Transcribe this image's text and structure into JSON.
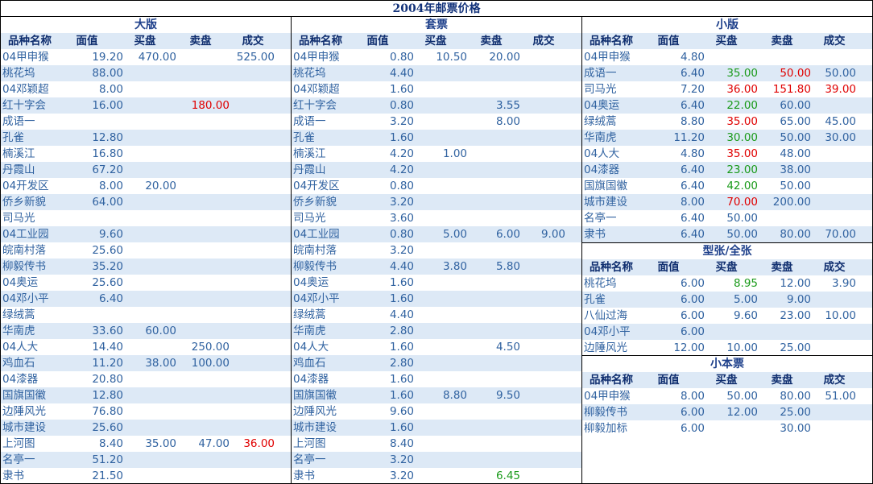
{
  "title": "2004年邮票价格",
  "headers": [
    "品种名称",
    "面值",
    "买盘",
    "卖盘",
    "成交"
  ],
  "colors": {
    "text": "#3062a0",
    "header": "#0e2d6e",
    "stripe": "#dde9f6",
    "buy": "#1a9a1a",
    "sell": "#e00000"
  },
  "sections": {
    "daban": {
      "title": "大版",
      "rows": [
        {
          "name": "04甲申猴",
          "face": "19.20",
          "buy": "470.00",
          "sell": "",
          "deal": "525.00"
        },
        {
          "name": "桃花坞",
          "face": "88.00",
          "buy": "",
          "sell": "",
          "deal": ""
        },
        {
          "name": "04邓颖超",
          "face": "8.00",
          "buy": "",
          "sell": "",
          "deal": ""
        },
        {
          "name": "红十字会",
          "face": "16.00",
          "buy": "",
          "sell": "180.00",
          "deal": "",
          "sell_color": "red"
        },
        {
          "name": "成语一",
          "face": "",
          "buy": "",
          "sell": "",
          "deal": ""
        },
        {
          "name": "孔雀",
          "face": "12.80",
          "buy": "",
          "sell": "",
          "deal": ""
        },
        {
          "name": "楠溪江",
          "face": "16.80",
          "buy": "",
          "sell": "",
          "deal": ""
        },
        {
          "name": "丹霞山",
          "face": "67.20",
          "buy": "",
          "sell": "",
          "deal": ""
        },
        {
          "name": "04开发区",
          "face": "8.00",
          "buy": "20.00",
          "sell": "",
          "deal": ""
        },
        {
          "name": "侨乡新貌",
          "face": "64.00",
          "buy": "",
          "sell": "",
          "deal": ""
        },
        {
          "name": "司马光",
          "face": "",
          "buy": "",
          "sell": "",
          "deal": ""
        },
        {
          "name": "04工业园",
          "face": "9.60",
          "buy": "",
          "sell": "",
          "deal": ""
        },
        {
          "name": "皖南村落",
          "face": "25.60",
          "buy": "",
          "sell": "",
          "deal": ""
        },
        {
          "name": "柳毅传书",
          "face": "35.20",
          "buy": "",
          "sell": "",
          "deal": ""
        },
        {
          "name": "04奥运",
          "face": "25.60",
          "buy": "",
          "sell": "",
          "deal": ""
        },
        {
          "name": "04邓小平",
          "face": "6.40",
          "buy": "",
          "sell": "",
          "deal": ""
        },
        {
          "name": "绿绒蒿",
          "face": "",
          "buy": "",
          "sell": "",
          "deal": ""
        },
        {
          "name": "华南虎",
          "face": "33.60",
          "buy": "60.00",
          "sell": "",
          "deal": ""
        },
        {
          "name": "04人大",
          "face": "14.40",
          "buy": "",
          "sell": "250.00",
          "deal": ""
        },
        {
          "name": "鸡血石",
          "face": "11.20",
          "buy": "38.00",
          "sell": "100.00",
          "deal": ""
        },
        {
          "name": "04漆器",
          "face": "20.80",
          "buy": "",
          "sell": "",
          "deal": ""
        },
        {
          "name": "国旗国徽",
          "face": "12.80",
          "buy": "",
          "sell": "",
          "deal": ""
        },
        {
          "name": "边陲风光",
          "face": "76.80",
          "buy": "",
          "sell": "",
          "deal": ""
        },
        {
          "name": "城市建设",
          "face": "25.60",
          "buy": "",
          "sell": "",
          "deal": ""
        },
        {
          "name": "上河图",
          "face": "8.40",
          "buy": "35.00",
          "sell": "47.00",
          "deal": "36.00",
          "deal_color": "red"
        },
        {
          "name": "名亭一",
          "face": "51.20",
          "buy": "",
          "sell": "",
          "deal": ""
        },
        {
          "name": "隶书",
          "face": "21.50",
          "buy": "",
          "sell": "",
          "deal": ""
        }
      ]
    },
    "taopiao": {
      "title": "套票",
      "rows": [
        {
          "name": "04甲申猴",
          "face": "0.80",
          "buy": "10.50",
          "sell": "20.00",
          "deal": ""
        },
        {
          "name": "桃花坞",
          "face": "4.40",
          "buy": "",
          "sell": "",
          "deal": ""
        },
        {
          "name": "04邓颖超",
          "face": "1.60",
          "buy": "",
          "sell": "",
          "deal": ""
        },
        {
          "name": "红十字会",
          "face": "0.80",
          "buy": "",
          "sell": "3.55",
          "deal": ""
        },
        {
          "name": "成语一",
          "face": "3.20",
          "buy": "",
          "sell": "8.00",
          "deal": ""
        },
        {
          "name": "孔雀",
          "face": "1.60",
          "buy": "",
          "sell": "",
          "deal": ""
        },
        {
          "name": "楠溪江",
          "face": "4.20",
          "buy": "1.00",
          "sell": "",
          "deal": ""
        },
        {
          "name": "丹霞山",
          "face": "4.20",
          "buy": "",
          "sell": "",
          "deal": ""
        },
        {
          "name": "04开发区",
          "face": "0.80",
          "buy": "",
          "sell": "",
          "deal": ""
        },
        {
          "name": "侨乡新貌",
          "face": "3.20",
          "buy": "",
          "sell": "",
          "deal": ""
        },
        {
          "name": "司马光",
          "face": "3.60",
          "buy": "",
          "sell": "",
          "deal": ""
        },
        {
          "name": "04工业园",
          "face": "0.80",
          "buy": "5.00",
          "sell": "6.00",
          "deal": "9.00"
        },
        {
          "name": "皖南村落",
          "face": "3.20",
          "buy": "",
          "sell": "",
          "deal": ""
        },
        {
          "name": "柳毅传书",
          "face": "4.40",
          "buy": "3.80",
          "sell": "5.80",
          "deal": ""
        },
        {
          "name": "04奥运",
          "face": "1.60",
          "buy": "",
          "sell": "",
          "deal": ""
        },
        {
          "name": "04邓小平",
          "face": "1.60",
          "buy": "",
          "sell": "",
          "deal": ""
        },
        {
          "name": "绿绒蒿",
          "face": "4.40",
          "buy": "",
          "sell": "",
          "deal": ""
        },
        {
          "name": "华南虎",
          "face": "2.80",
          "buy": "",
          "sell": "",
          "deal": ""
        },
        {
          "name": "04人大",
          "face": "1.60",
          "buy": "",
          "sell": "4.50",
          "deal": ""
        },
        {
          "name": "鸡血石",
          "face": "2.80",
          "buy": "",
          "sell": "",
          "deal": ""
        },
        {
          "name": "04漆器",
          "face": "1.60",
          "buy": "",
          "sell": "",
          "deal": ""
        },
        {
          "name": "国旗国徽",
          "face": "1.60",
          "buy": "8.80",
          "sell": "9.50",
          "deal": ""
        },
        {
          "name": "边陲风光",
          "face": "9.60",
          "buy": "",
          "sell": "",
          "deal": ""
        },
        {
          "name": "城市建设",
          "face": "1.60",
          "buy": "",
          "sell": "",
          "deal": ""
        },
        {
          "name": "上河图",
          "face": "8.40",
          "buy": "",
          "sell": "",
          "deal": ""
        },
        {
          "name": "名亭一",
          "face": "3.20",
          "buy": "",
          "sell": "",
          "deal": ""
        },
        {
          "name": "隶书",
          "face": "3.20",
          "buy": "",
          "sell": "6.45",
          "deal": "",
          "sell_color": "green"
        }
      ]
    },
    "xiaoban": {
      "title": "小版",
      "rows": [
        {
          "name": "04甲申猴",
          "face": "4.80",
          "buy": "",
          "sell": "",
          "deal": ""
        },
        {
          "name": "成语一",
          "face": "6.40",
          "buy": "35.00",
          "sell": "50.00",
          "deal": "50.00",
          "buy_color": "green",
          "sell_color": "red"
        },
        {
          "name": "司马光",
          "face": "7.20",
          "buy": "36.00",
          "sell": "151.80",
          "deal": "39.00",
          "buy_color": "red",
          "sell_color": "red",
          "deal_color": "red"
        },
        {
          "name": "04奥运",
          "face": "6.40",
          "buy": "22.00",
          "sell": "60.00",
          "deal": "",
          "buy_color": "green"
        },
        {
          "name": "绿绒蒿",
          "face": "8.80",
          "buy": "35.00",
          "sell": "65.00",
          "deal": "45.00",
          "buy_color": "red"
        },
        {
          "name": "华南虎",
          "face": "11.20",
          "buy": "30.00",
          "sell": "50.00",
          "deal": "30.00",
          "buy_color": "green"
        },
        {
          "name": "04人大",
          "face": "4.80",
          "buy": "35.00",
          "sell": "48.00",
          "deal": "",
          "buy_color": "red"
        },
        {
          "name": "04漆器",
          "face": "6.40",
          "buy": "23.00",
          "sell": "38.00",
          "deal": "",
          "buy_color": "green"
        },
        {
          "name": "国旗国徽",
          "face": "6.40",
          "buy": "42.00",
          "sell": "50.00",
          "deal": "",
          "buy_color": "green"
        },
        {
          "name": "城市建设",
          "face": "8.00",
          "buy": "70.00",
          "sell": "200.00",
          "deal": "",
          "buy_color": "red"
        },
        {
          "name": "名亭一",
          "face": "6.40",
          "buy": "50.00",
          "sell": "",
          "deal": ""
        },
        {
          "name": "隶书",
          "face": "6.40",
          "buy": "50.00",
          "sell": "80.00",
          "deal": "70.00"
        }
      ]
    },
    "xingzhang": {
      "title": "型张/全张",
      "rows": [
        {
          "name": "桃花坞",
          "face": "6.00",
          "buy": "8.95",
          "sell": "12.00",
          "deal": "3.90",
          "buy_color": "green"
        },
        {
          "name": "孔雀",
          "face": "6.00",
          "buy": "5.00",
          "sell": "9.00",
          "deal": ""
        },
        {
          "name": "八仙过海",
          "face": "6.00",
          "buy": "9.60",
          "sell": "23.00",
          "deal": "10.00"
        },
        {
          "name": "04邓小平",
          "face": "6.00",
          "buy": "",
          "sell": "",
          "deal": ""
        },
        {
          "name": "边陲风光",
          "face": "12.00",
          "buy": "10.00",
          "sell": "25.00",
          "deal": ""
        }
      ]
    },
    "xiaoben": {
      "title": "小本票",
      "rows": [
        {
          "name": "04甲申猴",
          "face": "8.00",
          "buy": "50.00",
          "sell": "80.00",
          "deal": "51.00"
        },
        {
          "name": "柳毅传书",
          "face": "6.00",
          "buy": "12.00",
          "sell": "25.00",
          "deal": ""
        },
        {
          "name": "柳毅加标",
          "face": "6.00",
          "buy": "",
          "sell": "30.00",
          "deal": ""
        }
      ]
    }
  }
}
